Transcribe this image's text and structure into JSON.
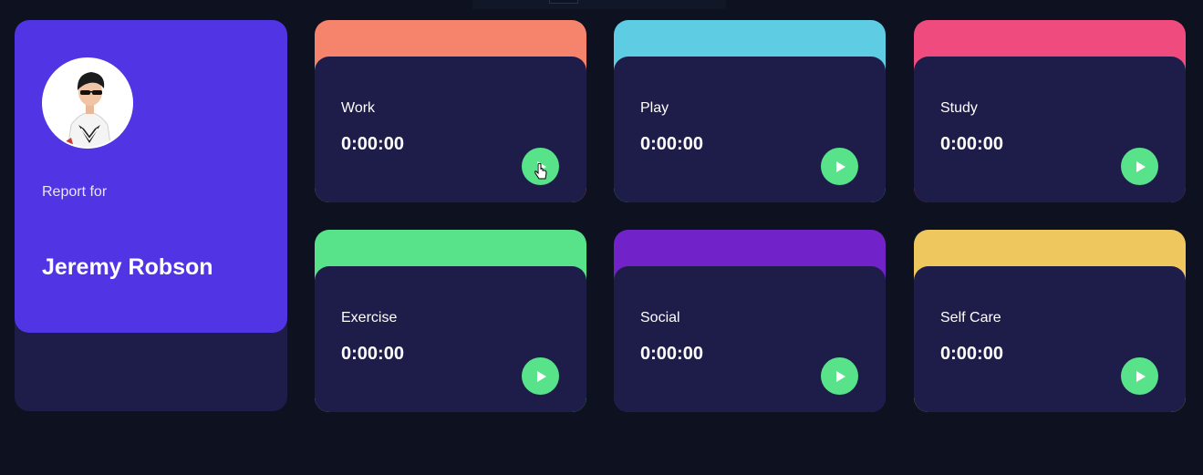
{
  "profile": {
    "report_label": "Report for",
    "name": "Jeremy Robson"
  },
  "activities": [
    {
      "label": "Work",
      "time": "0:00:00",
      "accent": "#f6836b"
    },
    {
      "label": "Play",
      "time": "0:00:00",
      "accent": "#5ecce3"
    },
    {
      "label": "Study",
      "time": "0:00:00",
      "accent": "#f04b7e"
    },
    {
      "label": "Exercise",
      "time": "0:00:00",
      "accent": "#58e38b"
    },
    {
      "label": "Social",
      "time": "0:00:00",
      "accent": "#7122c9"
    },
    {
      "label": "Self Care",
      "time": "0:00:00",
      "accent": "#eec75f"
    }
  ],
  "icons": {
    "play": "play-icon",
    "avatar": "avatar",
    "cursor": "hand-cursor-icon"
  },
  "colors": {
    "background": "#0d1120",
    "card": "#1e1d4a",
    "profile_accent": "#5135e4",
    "play_button": "#58e38b"
  }
}
